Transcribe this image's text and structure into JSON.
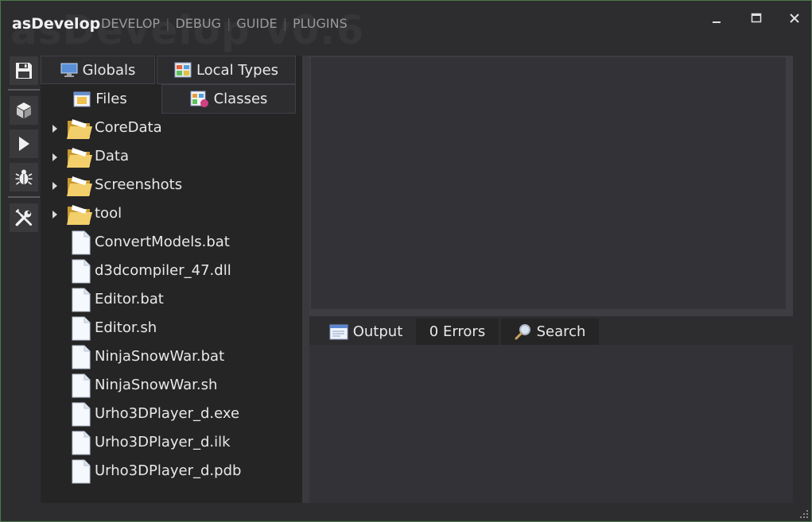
{
  "app": {
    "title": "asDevelop",
    "watermark": "asDevelop v0.6"
  },
  "menu": [
    {
      "label": "DEVELOP"
    },
    {
      "label": "DEBUG"
    },
    {
      "label": "GUIDE"
    },
    {
      "label": "PLUGINS"
    }
  ],
  "window_controls": {
    "minimize": "minimize-icon",
    "maximize": "maximize-icon",
    "close": "close-icon"
  },
  "toolbar": [
    {
      "icon": "save-icon"
    },
    {
      "icon": "cube-icon"
    },
    {
      "icon": "play-icon"
    },
    {
      "icon": "bug-icon"
    },
    {
      "icon": "tools-icon"
    }
  ],
  "left_tabs": {
    "globals": "Globals",
    "local_types": "Local Types",
    "files": "Files",
    "classes": "Classes",
    "active": "Files"
  },
  "files": [
    {
      "name": "CoreData",
      "type": "folder"
    },
    {
      "name": "Data",
      "type": "folder"
    },
    {
      "name": "Screenshots",
      "type": "folder"
    },
    {
      "name": "tool",
      "type": "folder"
    },
    {
      "name": "ConvertModels.bat",
      "type": "file"
    },
    {
      "name": "d3dcompiler_47.dll",
      "type": "file"
    },
    {
      "name": "Editor.bat",
      "type": "file"
    },
    {
      "name": "Editor.sh",
      "type": "file"
    },
    {
      "name": "NinjaSnowWar.bat",
      "type": "file"
    },
    {
      "name": "NinjaSnowWar.sh",
      "type": "file"
    },
    {
      "name": "Urho3DPlayer_d.exe",
      "type": "file"
    },
    {
      "name": "Urho3DPlayer_d.ilk",
      "type": "file"
    },
    {
      "name": "Urho3DPlayer_d.pdb",
      "type": "file"
    }
  ],
  "bottom_tabs": {
    "output": "Output",
    "errors": "0 Errors",
    "search": "Search",
    "active": "Output"
  },
  "colors": {
    "background": "#2d2d30",
    "panel": "#252526",
    "border_accent": "#4a7a48",
    "folder": "#e8c060"
  }
}
